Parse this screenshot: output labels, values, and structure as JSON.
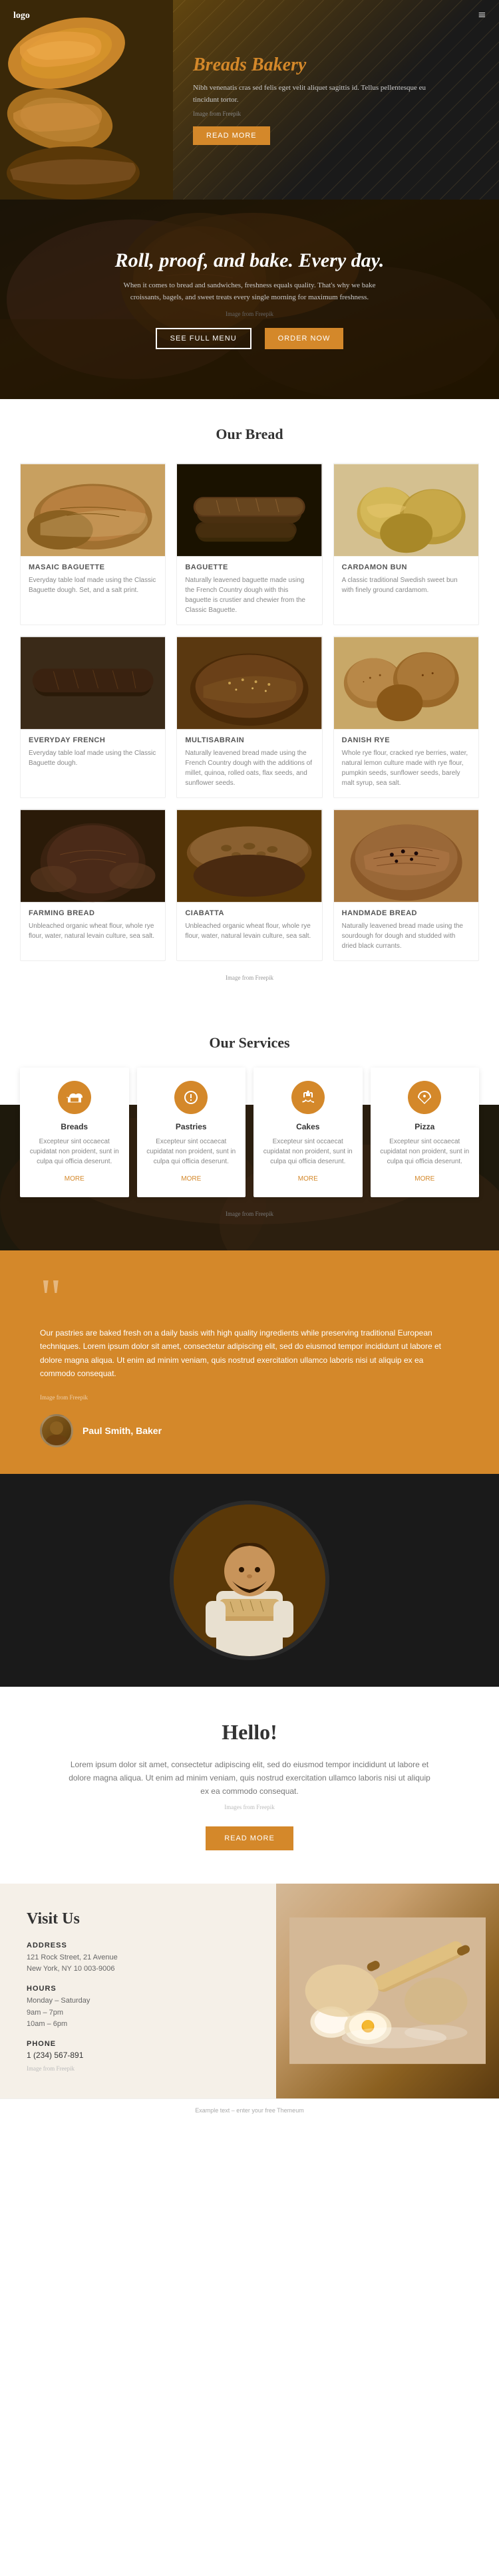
{
  "nav": {
    "logo": "logo",
    "menu_icon": "≡"
  },
  "hero": {
    "title": "Breads Bakery",
    "text": "Nibh venenatis cras sed felis eget velit aliquet sagittis id. Tellus pellentesque eu tincidunt tortor.",
    "image_credit": "Image from Freepik",
    "btn_read_more": "READ MORE"
  },
  "promo": {
    "title": "Roll, proof, and bake. Every day.",
    "text": "When it comes to bread and sandwiches, freshness equals quality. That's why we bake croissants, bagels, and sweet treats every single morning for maximum freshness.",
    "image_credit": "Image from Freepik",
    "btn_menu": "SEE FULL MENU",
    "btn_order": "ORDER NOW"
  },
  "our_bread": {
    "section_title": "Our Bread",
    "image_credit": "Image from Freepik",
    "breads": [
      {
        "id": "masaic-baguette",
        "title": "Masaic Baguette",
        "desc": "Everyday table loaf made using the Classic Baguette dough. Set, and a salt print."
      },
      {
        "id": "baguette",
        "title": "Baguette",
        "desc": "Naturally leavened baguette made using the French Country dough with this baguette is crustier and chewier from the Classic Baguette."
      },
      {
        "id": "cardamon-bun",
        "title": "Cardamon Bun",
        "desc": "A classic traditional Swedish sweet bun with finely ground cardamom."
      },
      {
        "id": "everyday-french",
        "title": "Everyday French",
        "desc": "Everyday table loaf made using the Classic Baguette dough."
      },
      {
        "id": "multisabrain",
        "title": "Multisabrain",
        "desc": "Naturally leavened bread made using the French Country dough with the additions of millet, quinoa, rolled oats, flax seeds, and sunflower seeds."
      },
      {
        "id": "danish-rye",
        "title": "Danish Rye",
        "desc": "Whole rye flour, cracked rye berries, water, natural lemon culture made with rye flour, pumpkin seeds, sunflower seeds, barely malt syrup, sea salt."
      },
      {
        "id": "farming-bread",
        "title": "Farming Bread",
        "desc": "Unbleached organic wheat flour, whole rye flour, water, natural levain culture, sea salt."
      },
      {
        "id": "ciabatta",
        "title": "Ciabatta",
        "desc": "Unbleached organic wheat flour, whole rye flour, water, natural levain culture, sea salt."
      },
      {
        "id": "handmade-bread",
        "title": "Handmade Bread",
        "desc": "Naturally leavened bread made using the sourdough for dough and studded with dried black currants."
      }
    ]
  },
  "services": {
    "section_title": "Our Services",
    "image_credit": "Image from Freepik",
    "items": [
      {
        "id": "breads",
        "icon": "🍞",
        "title": "Breads",
        "desc": "Excepteur sint occaecat cupidatat non proident, sunt in culpa qui officia deserunt.",
        "more": "MORE"
      },
      {
        "id": "pastries",
        "icon": "🥐",
        "title": "Pastries",
        "desc": "Excepteur sint occaecat cupidatat non proident, sunt in culpa qui officia deserunt.",
        "more": "MORE"
      },
      {
        "id": "cakes",
        "icon": "🎂",
        "title": "Cakes",
        "desc": "Excepteur sint occaecat cupidatat non proident, sunt in culpa qui officia deserunt.",
        "more": "MORE"
      },
      {
        "id": "pizza",
        "icon": "🍕",
        "title": "Pizza",
        "desc": "Excepteur sint occaecat cupidatat non proident, sunt in culpa qui officia deserunt.",
        "more": "MORE"
      }
    ]
  },
  "testimonial": {
    "quote": "Our pastries are baked fresh on a daily basis with high quality ingredients while preserving traditional European techniques. Lorem ipsum dolor sit amet, consectetur adipiscing elit, sed do eiusmod tempor incididunt ut labore et dolore magna aliqua. Ut enim ad minim veniam, quis nostrud exercitation ullamco laboris nisi ut aliquip ex ea commodo consequat.",
    "image_credit": "Image from Freepik",
    "author_name": "Paul Smith, Baker",
    "author_role": "Baker"
  },
  "hello": {
    "title": "Hello!",
    "text1": "Lorem ipsum dolor sit amet, consectetur adipiscing elit, sed do eiusmod tempor incididunt ut labore et dolore magna aliqua. Ut enim ad minim veniam, quis nostrud exercitation ullamco laboris nisi ut aliquip ex ea commodo consequat.",
    "image_credit": "Images from Freepik",
    "btn": "READ MORE"
  },
  "visit": {
    "title": "Visit Us",
    "address_label": "ADDRESS",
    "address": "121 Rock Street, 21 Avenue\nNew York, NY 10 003-9006",
    "hours_label": "HOURS",
    "hours": "Monday – Saturday\n9am – 7pm",
    "hours2": "10am – 6pm",
    "phone_label": "PHONE",
    "phone": "1 (234) 567-891",
    "image_credit": "Image from Freepik"
  },
  "footer": {
    "text": "Example text – enter your free Themeum"
  }
}
